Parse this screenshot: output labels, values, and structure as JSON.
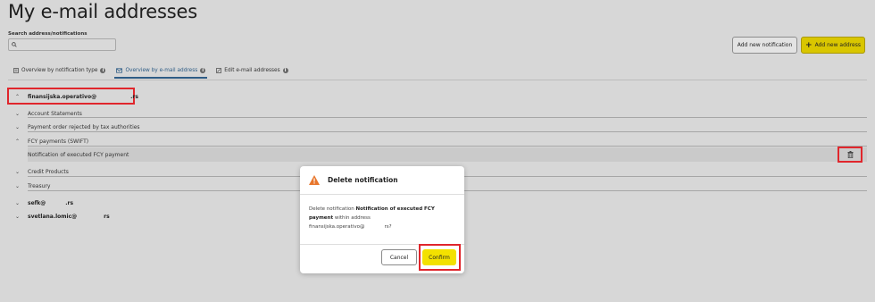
{
  "page": {
    "title": "My e-mail addresses"
  },
  "search": {
    "label": "Search address/notifications",
    "value": "",
    "placeholder": ""
  },
  "actions": {
    "add_notification": "Add new notification",
    "add_address": "Add new address"
  },
  "tabs": [
    {
      "label": "Overview by notification type",
      "icon": "list-icon",
      "active": false
    },
    {
      "label": "Overview by e-mail address",
      "icon": "mail-icon",
      "active": true
    },
    {
      "label": "Edit e-mail addresses",
      "icon": "edit-icon",
      "active": false
    }
  ],
  "tree": {
    "address1": "finansijska.operativo@",
    "address1_domain": ".rs",
    "groups": [
      {
        "label": "Account Statements",
        "expanded": false
      },
      {
        "label": "Payment order rejected by tax authorities",
        "expanded": false
      },
      {
        "label": "FCY payments (SWIFT)",
        "expanded": true
      },
      {
        "label": "Notification of executed FCY payment",
        "expanded": false
      },
      {
        "label": "Credit Products",
        "expanded": false
      },
      {
        "label": "Treasury",
        "expanded": false
      }
    ],
    "address2": "sefk@",
    "address2_domain": ".rs",
    "address3": "svetlana.lomic@",
    "address3_domain": "rs"
  },
  "modal": {
    "title": "Delete notification",
    "body_prefix": "Delete notification ",
    "body_name": "Notification of executed FCY payment",
    "body_suffix": " within address",
    "body_address": "finansijska.operativo@",
    "body_address_end": "rs?",
    "cancel": "Cancel",
    "confirm": "Confirm"
  },
  "colors": {
    "accent": "#2e5c85",
    "primary_button": "#f3e100",
    "highlight": "#e0262c",
    "warning": "#e8762c"
  }
}
